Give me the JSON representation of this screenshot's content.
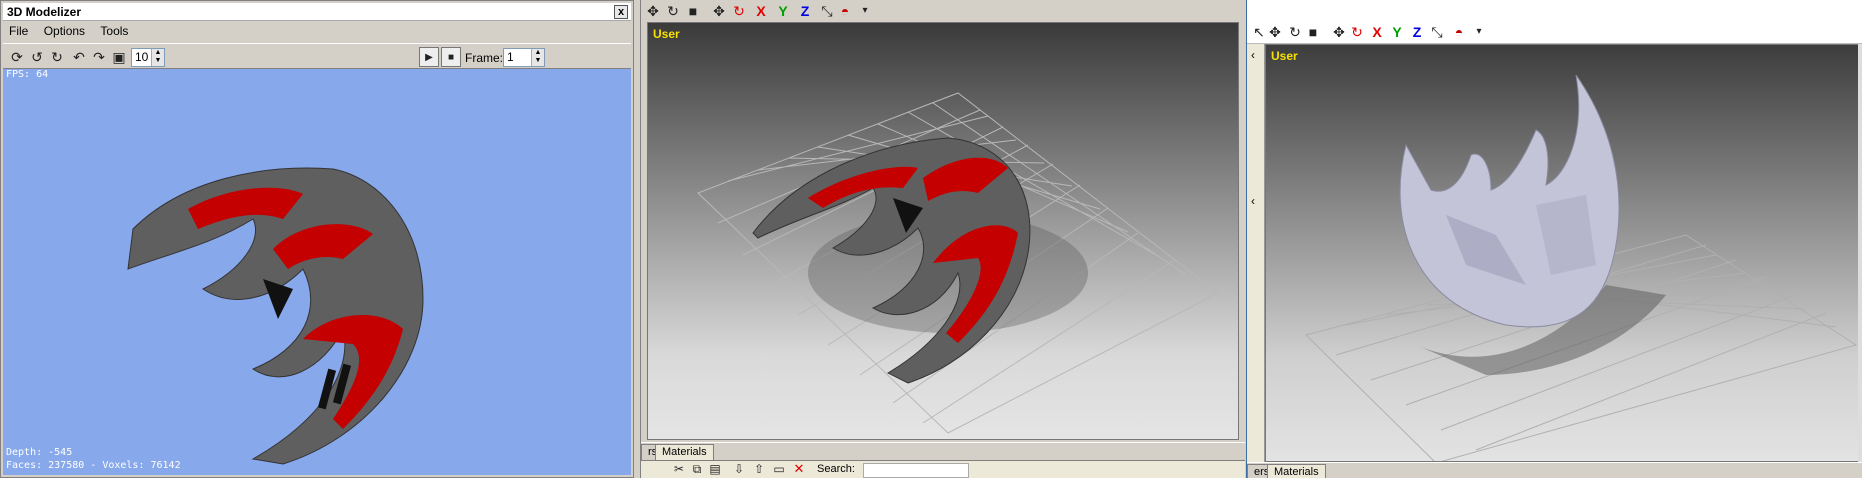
{
  "modelizer": {
    "title": "3D Modelizer",
    "close_glyph": "x",
    "menu": [
      "File",
      "Options",
      "Tools"
    ],
    "toolbar": {
      "spin_value": "10",
      "frame_label": "Frame:",
      "frame_value": "1"
    },
    "viewport": {
      "fps": "FPS: 64",
      "depth": "Depth: -545",
      "stats": "Faces: 237580 - Voxels: 76142",
      "background": "#88a8ec"
    }
  },
  "center": {
    "viewport_label": "User",
    "tabs": [
      "rs",
      "Materials"
    ],
    "search_label": "Search:"
  },
  "right": {
    "viewport_label": "User",
    "tabs": [
      "ers",
      "Materials"
    ]
  },
  "colors": {
    "axis_x": "#e00000",
    "axis_y": "#00a000",
    "axis_z": "#0000e0",
    "user_label": "#f7e000",
    "ship_red": "#c40000"
  },
  "axis_letters": [
    "X",
    "Y",
    "Z"
  ]
}
